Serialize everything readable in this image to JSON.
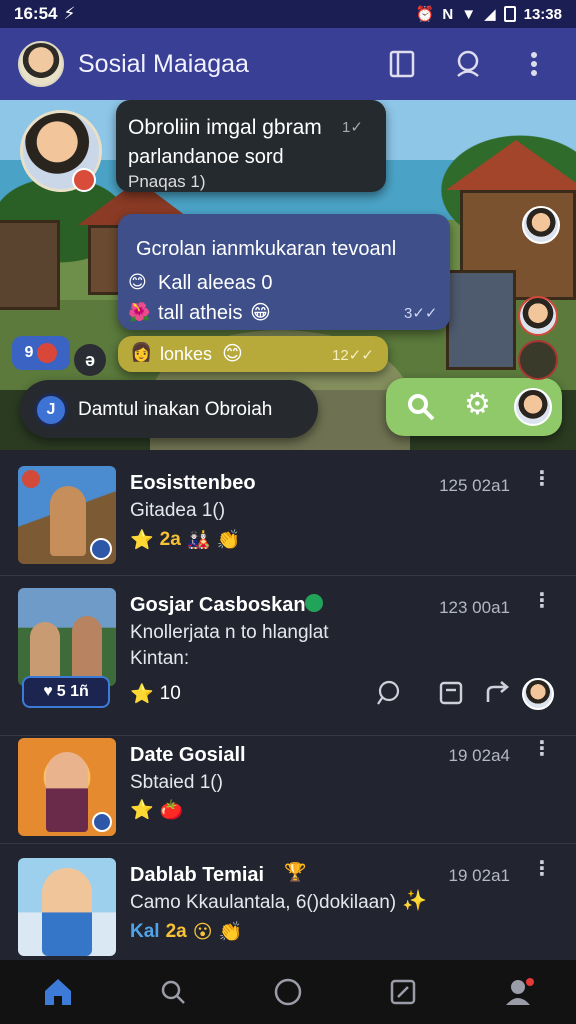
{
  "status": {
    "time": "16:54",
    "clock": "13:38"
  },
  "appbar": {
    "title": "Sosial Maiagaa"
  },
  "hero": {
    "post_title": "Obroliin imgal gbram",
    "post_title_mark": "1✓",
    "post_body": "parlandanoe sord",
    "post_meta": "Pnaqas 1)",
    "blue_title": "Gcrolan ianmkukaran tevoanl",
    "blue_line1": "Kall aleeas 0",
    "blue_line2": "tall atheis",
    "blue_time": "3✓✓",
    "yellow_text": "lonkes",
    "yellow_time": "12✓✓",
    "pill_text": "Damtul inakan Obroiah",
    "reaction_badge": "9"
  },
  "feed": [
    {
      "title": "Eosisttenbeo",
      "sub": "Gitadea 1()",
      "time": "125 02a1",
      "reacts": "2a"
    },
    {
      "title": "Gosjar Casboskan",
      "sub": "Knollerjata n to hlanglat",
      "sub2": "Kintan:",
      "time": "123 00a1",
      "likes": "5 1ñ",
      "stars": "10"
    },
    {
      "title": "Date Gosiall",
      "sub": "Sbtaied 1()",
      "time": "19 02a4"
    },
    {
      "title": "Dablab Temiai",
      "sub": "Camo Kkaulantala, 6()dokilaan)",
      "time": "19 02a1",
      "reacts_label": "Kal",
      "reacts": "2a"
    }
  ],
  "colors": {
    "appbar": "#3a3f96",
    "statusbar": "#1b1e52",
    "feed_bg": "#22252f",
    "nav_bg": "#121212",
    "accent_blue": "#3d7bd9"
  }
}
